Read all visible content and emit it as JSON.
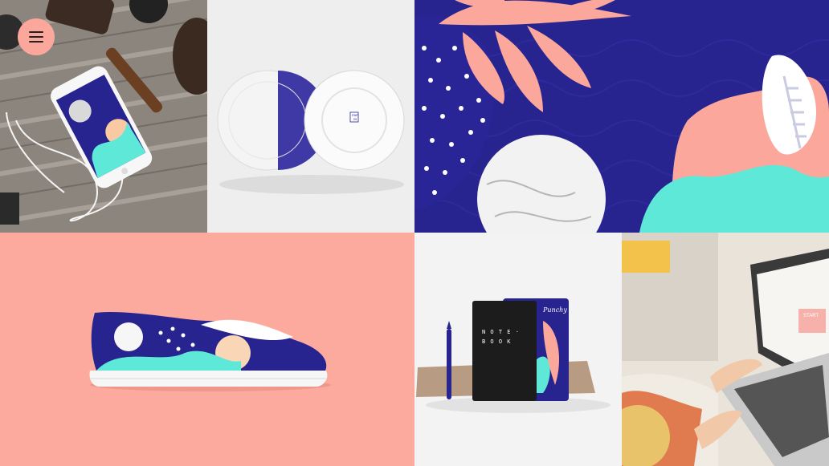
{
  "header": {
    "menu_icon": "hamburger-menu-icon"
  },
  "gallery": {
    "tiles": [
      {
        "name": "phone-mockup",
        "bg": "#7c7671"
      },
      {
        "name": "plates-mockup",
        "bg": "#efefef"
      },
      {
        "name": "pattern-illustration",
        "bg": "#27238f"
      },
      {
        "name": "shoe-mockup",
        "bg": "#fdaa9e"
      },
      {
        "name": "notebook-mockup",
        "bg": "#f2f2f2"
      },
      {
        "name": "laptop-photo",
        "bg": "#e8e2d8"
      }
    ],
    "plate_stamp": "PAP\n29",
    "notebook_title": [
      "N O T E ·",
      "B O O K"
    ],
    "notebook_brand": "Punchy",
    "laptop_text": "START"
  },
  "colors": {
    "navy": "#27238f",
    "coral": "#fba79c",
    "mint": "#5ee8d8",
    "white": "#ffffff"
  }
}
